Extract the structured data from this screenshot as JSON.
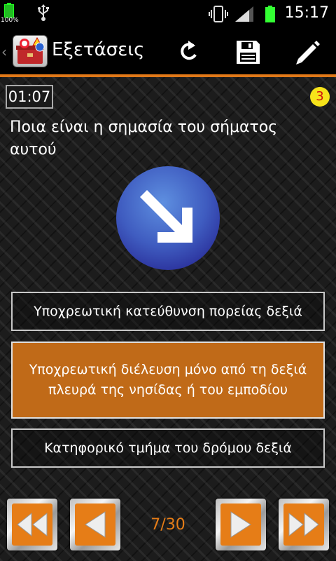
{
  "status_bar": {
    "battery_percent": "100%",
    "time": "15:17",
    "icons": [
      "battery-icon",
      "usb-icon",
      "vibrate-icon",
      "signal-icon",
      "battery-icon"
    ]
  },
  "action_bar": {
    "title": "Εξετάσεις",
    "actions": [
      "refresh-icon",
      "save-icon",
      "edit-icon"
    ]
  },
  "quiz": {
    "timer": "01:07",
    "counter": "3",
    "question": "Ποια είναι η σημασία του σήματος αυτού",
    "sign": {
      "type": "mandatory-keep-right",
      "background": "#4a56c8",
      "arrow": "#ffffff"
    },
    "answers": [
      {
        "text": "Υποχρεωτική κατεύθυνση πορείας δεξιά",
        "selected": false
      },
      {
        "text": "Υποχρεωτική διέλευση μόνο από τη δεξιά πλευρά της νησίδας ή του εμποδίου",
        "selected": true
      },
      {
        "text": "Κατηφορικό τμήμα του δρόμου δεξιά",
        "selected": false
      }
    ]
  },
  "navigation": {
    "page": "7/30",
    "buttons": [
      "first-icon",
      "previous-icon",
      "next-icon",
      "last-icon"
    ],
    "accent": "#e67d17"
  }
}
